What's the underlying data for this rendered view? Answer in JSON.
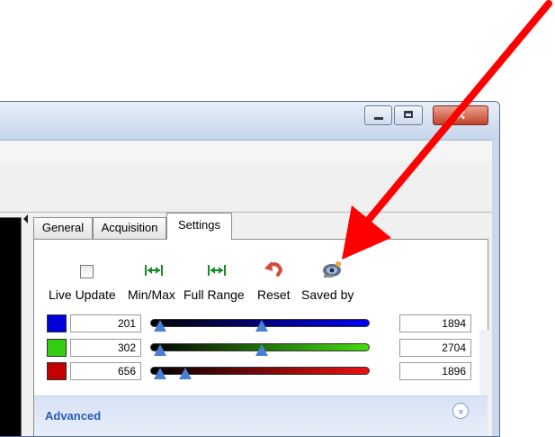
{
  "titlebar": {
    "close_symbol": "✕"
  },
  "tabs": {
    "general": "General",
    "acquisition": "Acquisition",
    "settings": "Settings",
    "active": "Settings"
  },
  "actions": {
    "live_update": "Live Update",
    "live_update_checked": false,
    "min_max": "Min/Max",
    "full_range": "Full Range",
    "reset": "Reset",
    "saved_by": "Saved by"
  },
  "channels": [
    {
      "color": "#0000dd",
      "min": "201",
      "max": "1894"
    },
    {
      "color": "#33cc11",
      "min": "302",
      "max": "2704"
    },
    {
      "color": "#c40000",
      "min": "656",
      "max": "1896"
    }
  ],
  "advanced": {
    "label": "Advanced",
    "chevron": "»"
  },
  "colors": {
    "accent_arrow": "#ff0000",
    "thumb": "#4a7fd6",
    "advanced_text": "#2a5bb5"
  },
  "icons": [
    "checkbox-icon",
    "min-max-arrows-icon",
    "full-range-arrows-icon",
    "reset-undo-icon",
    "saved-by-icon"
  ]
}
